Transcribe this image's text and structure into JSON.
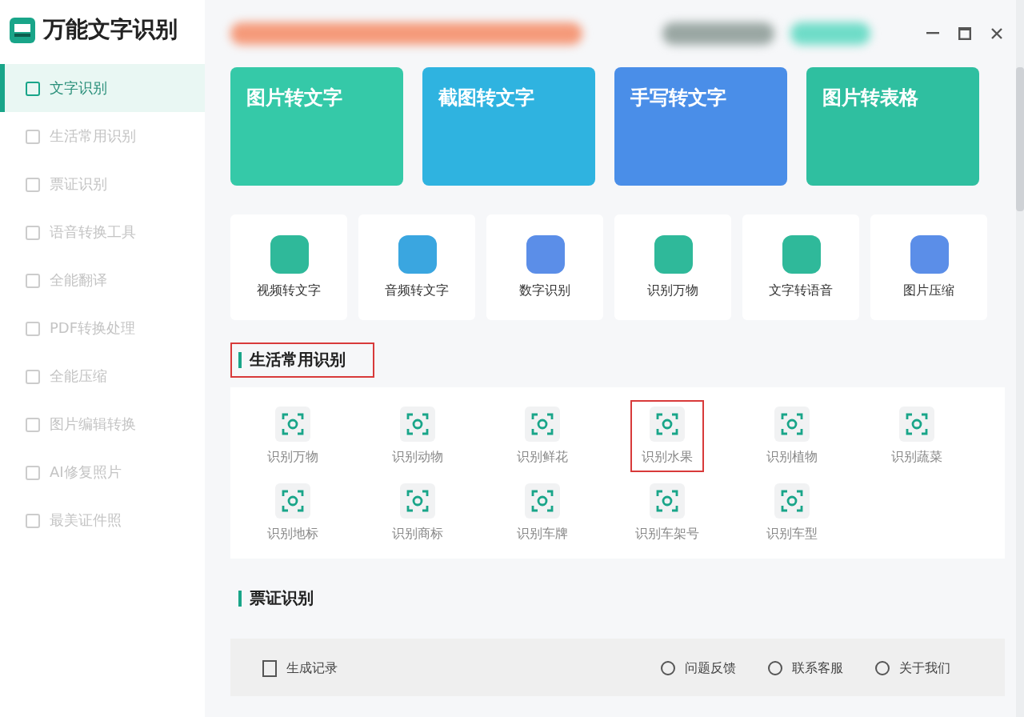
{
  "app": {
    "title": "万能文字识别"
  },
  "sidebar": {
    "items": [
      {
        "label": "文字识别",
        "selected": true
      },
      {
        "label": "生活常用识别",
        "selected": false
      },
      {
        "label": "票证识别",
        "selected": false
      },
      {
        "label": "语音转换工具",
        "selected": false
      },
      {
        "label": "全能翻译",
        "selected": false
      },
      {
        "label": "PDF转换处理",
        "selected": false
      },
      {
        "label": "全能压缩",
        "selected": false
      },
      {
        "label": "图片编辑转换",
        "selected": false
      },
      {
        "label": "AI修复照片",
        "selected": false
      },
      {
        "label": "最美证件照",
        "selected": false
      }
    ]
  },
  "banners": [
    {
      "title": "图片转文字",
      "color": "#35c9a8"
    },
    {
      "title": "截图转文字",
      "color": "#2fb3e0"
    },
    {
      "title": "手写转文字",
      "color": "#4a8ee8"
    },
    {
      "title": "图片转表格",
      "color": "#2fbfa0"
    }
  ],
  "tools": [
    {
      "label": "视频转文字",
      "color": "#2fb99a"
    },
    {
      "label": "音频转文字",
      "color": "#3aa6e0"
    },
    {
      "label": "数字识别",
      "color": "#5b8ee8"
    },
    {
      "label": "识别万物",
      "color": "#2fb99a"
    },
    {
      "label": "文字转语音",
      "color": "#2fb99a"
    },
    {
      "label": "图片压缩",
      "color": "#5b8ee8"
    }
  ],
  "sections": [
    {
      "title": "生活常用识别",
      "highlighted": true,
      "items": [
        {
          "label": "识别万物",
          "highlighted": false
        },
        {
          "label": "识别动物",
          "highlighted": false
        },
        {
          "label": "识别鲜花",
          "highlighted": false
        },
        {
          "label": "识别水果",
          "highlighted": true
        },
        {
          "label": "识别植物",
          "highlighted": false
        },
        {
          "label": "识别蔬菜",
          "highlighted": false
        },
        {
          "label": "识别地标",
          "highlighted": false
        },
        {
          "label": "识别商标",
          "highlighted": false
        },
        {
          "label": "识别车牌",
          "highlighted": false
        },
        {
          "label": "识别车架号",
          "highlighted": false
        },
        {
          "label": "识别车型",
          "highlighted": false
        }
      ]
    },
    {
      "title": "票证识别",
      "highlighted": false
    }
  ],
  "footer": {
    "record": "生成记录",
    "links": [
      "问题反馈",
      "联系客服",
      "关于我们"
    ]
  }
}
